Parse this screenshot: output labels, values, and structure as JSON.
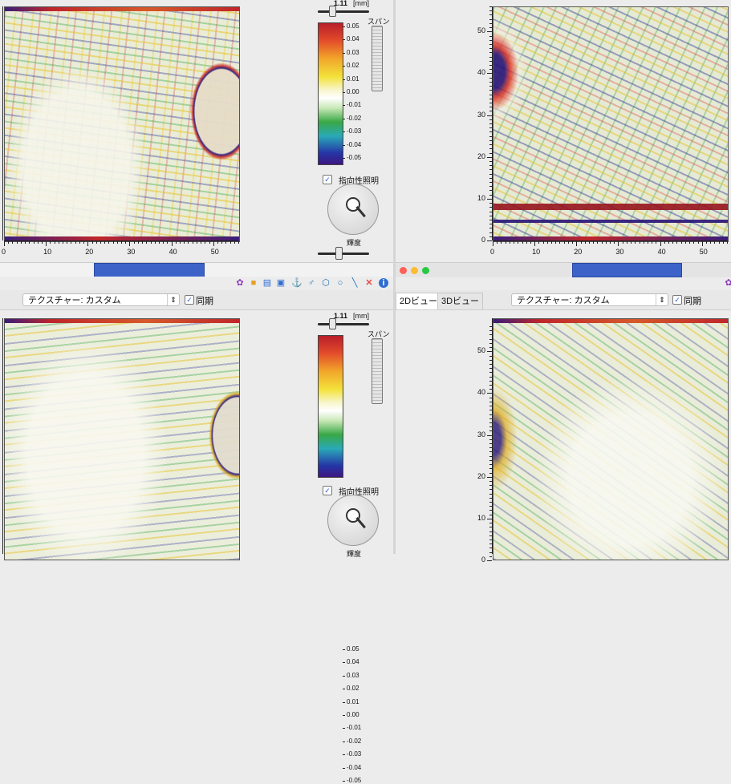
{
  "panels": {
    "top_left": {
      "x_ticks": [
        "0",
        "10",
        "20",
        "30",
        "40",
        "50"
      ]
    },
    "top_right": {
      "x_ticks": [
        "0",
        "10",
        "20",
        "30",
        "40",
        "50"
      ],
      "y_ticks": [
        "0",
        "10",
        "20",
        "30",
        "40",
        "50"
      ]
    },
    "bottom_right": {
      "y_ticks": [
        "0",
        "10",
        "20",
        "30",
        "40",
        "50"
      ]
    }
  },
  "colorbar_top": {
    "value": "1.11",
    "unit": "[mm]",
    "span_label": "スパン",
    "ticks": [
      "0.05",
      "0.04",
      "0.03",
      "0.02",
      "0.01",
      "0.00",
      "-0.01",
      "-0.02",
      "-0.03",
      "-0.04",
      "-0.05"
    ],
    "directional_lighting_label": "指向性照明",
    "directional_lighting_checked": true,
    "brightness_label": "輝度"
  },
  "colorbar_bottom": {
    "value": "1.11",
    "unit": "[mm]",
    "span_label": "スパン",
    "ticks": [
      "0.05",
      "0.04",
      "0.03",
      "0.02",
      "0.01",
      "0.00",
      "-0.01",
      "-0.02",
      "-0.03",
      "-0.04",
      "-0.05"
    ],
    "directional_lighting_label": "指向性照明",
    "directional_lighting_checked": true,
    "brightness_label": "輝度"
  },
  "toolbar_left": {
    "texture_select_value": "テクスチャー: カスタム",
    "sync_label": "同期",
    "sync_checked": true
  },
  "toolbar_right": {
    "tab_2d": "2Dビュー",
    "tab_3d": "3Dビュー",
    "texture_select_value": "テクスチャー: カスタム",
    "sync_label": "同期",
    "sync_checked": true
  },
  "toolbar_icons": [
    "settings-icon",
    "folder-icon",
    "save-icon",
    "export-icon",
    "anchor-icon",
    "marker-icon",
    "lasso-icon",
    "circle-icon",
    "line-icon",
    "delete-icon",
    "info-icon"
  ],
  "colors": {
    "accent_blue": "#3d63c9",
    "window_red": "#fe5f57",
    "window_yellow": "#febc2e",
    "window_green": "#28c840"
  }
}
